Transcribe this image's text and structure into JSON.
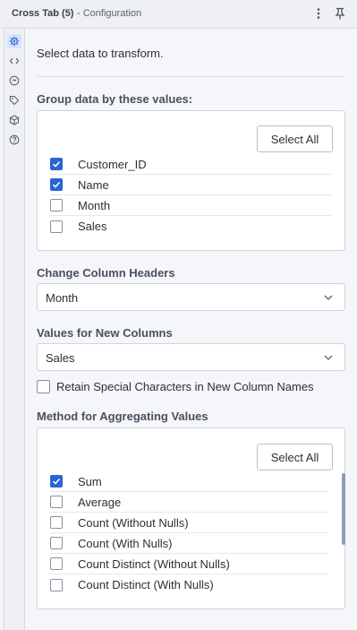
{
  "header": {
    "title": "Cross Tab (5)",
    "subtitle": "- Configuration"
  },
  "header_icons": {
    "menu": "vertical-dots-icon",
    "pin": "pin-icon"
  },
  "sidebar": {
    "icons": [
      "gear-icon",
      "code-icon",
      "settings-circle-icon",
      "tag-icon",
      "cube-icon",
      "help-icon"
    ],
    "active": "gear-icon"
  },
  "intro": "Select data to transform.",
  "group": {
    "label": "Group data by these values:",
    "select_all": "Select All",
    "items": [
      {
        "label": "Customer_ID",
        "checked": true
      },
      {
        "label": "Name",
        "checked": true
      },
      {
        "label": "Month",
        "checked": false
      },
      {
        "label": "Sales",
        "checked": false
      }
    ]
  },
  "headers": {
    "label": "Change Column Headers",
    "value": "Month"
  },
  "values": {
    "label": "Values for New Columns",
    "value": "Sales"
  },
  "retain": {
    "label": "Retain Special Characters in New Column Names",
    "checked": false
  },
  "method": {
    "label": "Method for Aggregating Values",
    "select_all": "Select All",
    "items": [
      {
        "label": "Sum",
        "checked": true
      },
      {
        "label": "Average",
        "checked": false
      },
      {
        "label": "Count (Without Nulls)",
        "checked": false
      },
      {
        "label": "Count (With Nulls)",
        "checked": false
      },
      {
        "label": "Count Distinct (Without Nulls)",
        "checked": false
      },
      {
        "label": "Count Distinct (With Nulls)",
        "checked": false
      }
    ]
  },
  "colors": {
    "accent": "#2a63d6",
    "scrollbar": "#8d9bb5"
  }
}
